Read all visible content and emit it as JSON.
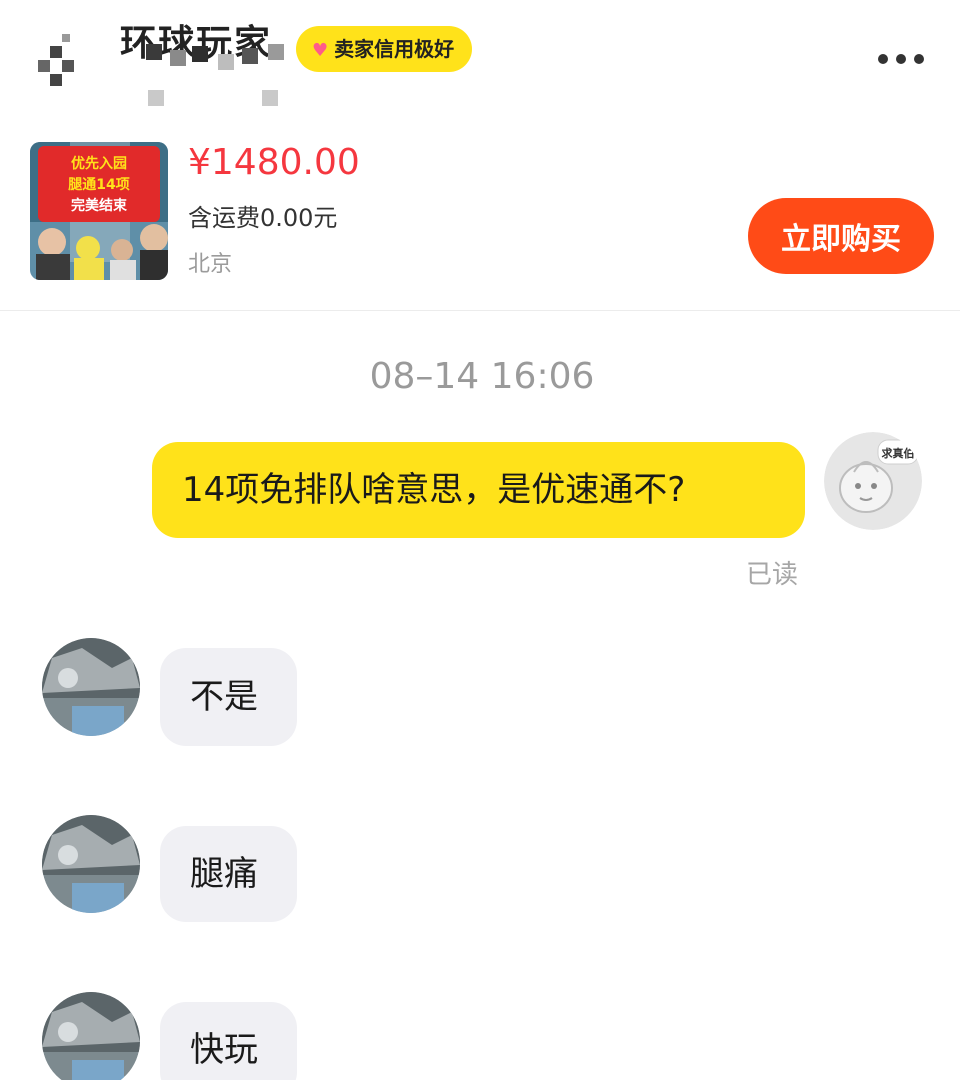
{
  "header": {
    "title": "环球玩家",
    "seller_badge": "卖家信用极好",
    "icons": {
      "back": "back-arrow-icon",
      "more": "more-dots-icon"
    }
  },
  "product": {
    "thumbnail_text": [
      "优先入园",
      "腿通14项",
      "完美结束"
    ],
    "price": "¥1480.00",
    "shipping": "含运费0.00元",
    "location": "北京",
    "buy_label": "立即购买"
  },
  "chat": {
    "timestamp": "08–14 16:06",
    "my_avatar_text": "求真伯",
    "messages": [
      {
        "from": "me",
        "text": "14项免排队啥意思，是优速通不?",
        "status": "已读"
      },
      {
        "from": "seller",
        "text": "不是"
      },
      {
        "from": "seller",
        "text": "腿痛"
      },
      {
        "from": "seller",
        "text": "快玩"
      }
    ]
  },
  "colors": {
    "accent_yellow": "#ffe21a",
    "buy_orange": "#ff4b17",
    "price_red": "#f5373f",
    "bubble_gray": "#f0f0f4"
  }
}
